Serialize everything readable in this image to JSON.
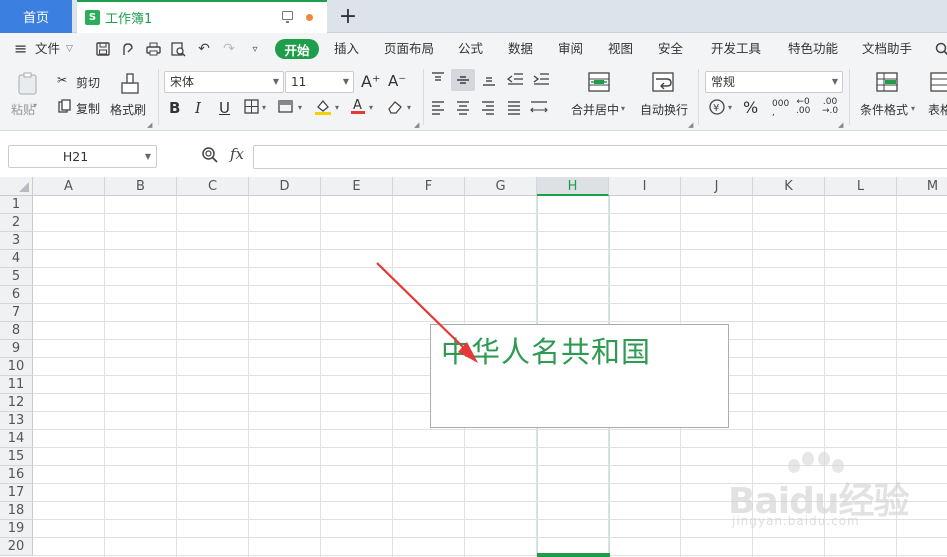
{
  "tabs": {
    "home": "首页",
    "document": "工作簿1",
    "sheet_icon": "S",
    "new_tab": "+"
  },
  "menu": {
    "hamburger": "≡",
    "file": "文件",
    "items": [
      "开始",
      "插入",
      "页面布局",
      "公式",
      "数据",
      "审阅",
      "视图",
      "安全",
      "开发工具",
      "特色功能",
      "文档助手"
    ]
  },
  "ribbon": {
    "paste": "粘贴",
    "cut": "剪切",
    "copy": "复制",
    "format_painter": "格式刷",
    "font_name": "宋体",
    "font_size": "11",
    "grow_font": "A⁺",
    "shrink_font": "A⁻",
    "bold": "B",
    "italic": "I",
    "underline": "U",
    "merge_center": "合并居中",
    "auto_wrap": "自动换行",
    "number_format": "常规",
    "percent": "%",
    "conditional_format": "条件格式",
    "table_style": "表格"
  },
  "formula": {
    "name_box": "H21",
    "fx": "fx",
    "value": ""
  },
  "columns": [
    "A",
    "B",
    "C",
    "D",
    "E",
    "F",
    "G",
    "H",
    "I",
    "J",
    "K",
    "L",
    "M"
  ],
  "active_column": "H",
  "rows": [
    "1",
    "2",
    "3",
    "4",
    "5",
    "6",
    "7",
    "8",
    "9",
    "10",
    "11",
    "12",
    "13",
    "14",
    "15",
    "16",
    "17",
    "18",
    "19",
    "20"
  ],
  "textbox": {
    "text": "中华人名共和国",
    "color": "#2e9a52"
  },
  "annotation_arrow": {
    "color": "#e53935"
  },
  "watermark": {
    "brand": "Baidu经验",
    "url": "jingyan.baidu.com"
  },
  "colors": {
    "accent": "#1f9d4b",
    "home_tab": "#3b7fe0"
  }
}
